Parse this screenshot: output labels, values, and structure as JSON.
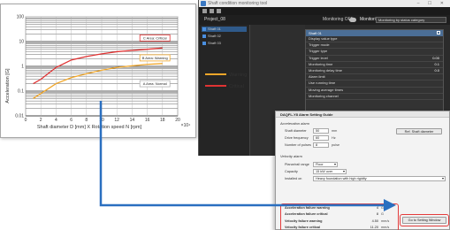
{
  "app": {
    "title": "Shaft condition monitoring tool",
    "window_controls": "– ☐ ✕",
    "header": {
      "project": "Project_08",
      "monitoring_label": "Monitoring OFF",
      "toggle_state": "off",
      "toggle_label": "Monitoring",
      "mode_value": "Monitoring by status category"
    },
    "tree": [
      {
        "label": "Shaft 01",
        "selected": true
      },
      {
        "label": "Shaft 02",
        "selected": false
      },
      {
        "label": "Shaft 03",
        "selected": false
      }
    ],
    "props": {
      "title": "Shaft 01",
      "rows": [
        {
          "label": "Display value type",
          "value": ""
        },
        {
          "label": "Trigger mode",
          "value": ""
        },
        {
          "label": "Trigger type",
          "value": ""
        },
        {
          "label": "Trigger level",
          "value": "0.00"
        },
        {
          "label": "Monitoring time",
          "value": "0.1"
        },
        {
          "label": "Monitoring delay time",
          "value": "0.0"
        },
        {
          "label": "Alarm limit",
          "value": ""
        },
        {
          "label": "Use running time",
          "value": ""
        },
        {
          "label": "Moving average times",
          "value": ""
        },
        {
          "label": "Monitoring channel",
          "value": ""
        }
      ]
    }
  },
  "panel": {
    "title": "DAQFL-Y8 Alarm Setting Guide",
    "acceleration_alarm": {
      "section": "Acceleration alarm",
      "shaft_diameter_label": "Shaft diameter",
      "shaft_diameter_value": "50",
      "shaft_diameter_unit": "mm",
      "drive_frequency_label": "Drive frequency",
      "drive_frequency_value": "60",
      "drive_frequency_unit": "Hz",
      "pulses_label": "Number of pulses",
      "pulses_value": "8",
      "pulses_unit": "pulse",
      "ref_button": "Ref. Shaft diameter"
    },
    "velocity_alarm": {
      "section": "Velocity alarm",
      "planar_range_label": "Planar/rail range",
      "floor_label": "Floor",
      "capacity_label": "Capacity",
      "capacity_value": "15 kW over",
      "installed_on_label": "Installed on",
      "installed_on_value": "Heavy foundation with high rigidity"
    },
    "results": [
      {
        "label": "Acceleration failure warning",
        "value": "4",
        "unit": "G"
      },
      {
        "label": "Acceleration failure critical",
        "value": "8",
        "unit": "G"
      },
      {
        "label": "Velocity failure warning",
        "value": "4.50",
        "unit": "mm/s"
      },
      {
        "label": "Velocity failure critical",
        "value": "11.20",
        "unit": "mm/s"
      }
    ],
    "go_button": "Go to Setting Window"
  },
  "chart_data": {
    "type": "line",
    "ylabel": "Acceleration [G]",
    "xlabel": "Shaft diameter D [mm] X Rotation speed N [rpm]",
    "x_multiplier": "×10⁴",
    "xlim": [
      0,
      20
    ],
    "ylim": [
      0.01,
      100
    ],
    "y_scale": "log",
    "x_ticks": [
      "0",
      "2",
      "4",
      "6",
      "8",
      "10",
      "12",
      "14",
      "16",
      "18",
      "20"
    ],
    "y_ticks": [
      "0.01",
      "0.1",
      "1",
      "10",
      "100"
    ],
    "grid": true,
    "colors": {
      "critical": "#e03333",
      "warning": "#f0a62a",
      "frame": "#b0b0b0",
      "grid": "#222222"
    },
    "series": [
      {
        "name": "Critical",
        "x": [
          1,
          2,
          4,
          6,
          8,
          10,
          12,
          14,
          16,
          18
        ],
        "y": [
          0.2,
          0.3,
          0.9,
          1.8,
          2.5,
          3.2,
          3.9,
          4.4,
          4.9,
          5.5
        ]
      },
      {
        "name": "Warning",
        "x": [
          1,
          2,
          4,
          6,
          8,
          10,
          12,
          14,
          16,
          18
        ],
        "y": [
          0.05,
          0.08,
          0.2,
          0.35,
          0.5,
          0.7,
          0.9,
          1.05,
          1.2,
          1.3
        ]
      }
    ],
    "annotations": [
      {
        "text": "C Area: Critical",
        "x": 17,
        "y": 14
      },
      {
        "text": "B Area: Warning",
        "x": 17,
        "y": 2.2
      },
      {
        "text": "A Area: Normal",
        "x": 17,
        "y": 0.2
      }
    ],
    "legend": [
      "Warning",
      "Critical"
    ]
  }
}
